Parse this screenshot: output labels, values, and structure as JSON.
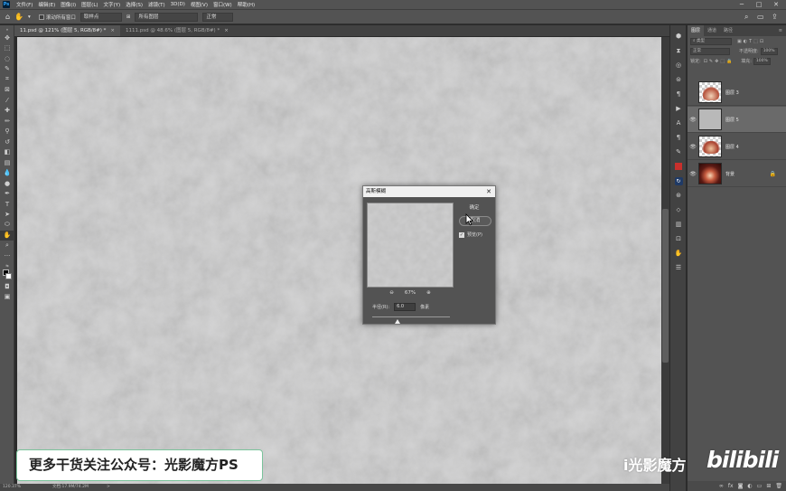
{
  "menu": {
    "logo": "Ps",
    "items": [
      "文件(F)",
      "编辑(E)",
      "图像(I)",
      "图层(L)",
      "文字(Y)",
      "选择(S)",
      "滤镜(T)",
      "3D(D)",
      "视图(V)",
      "窗口(W)",
      "帮助(H)"
    ],
    "window_controls": [
      "─",
      "□",
      "✕"
    ]
  },
  "options_bar": {
    "sample_all_layers": "滚动所有窗口",
    "sample_size": "取样点",
    "mode_label": "所有图层",
    "blend": "正常"
  },
  "tabs": [
    {
      "label": "11.psd @ 121% (图层 5, RGB/8#) *",
      "close": "×",
      "active": true
    },
    {
      "label": "1111.psd @ 48.6% (图层 5, RGB/8#) *",
      "close": "×",
      "active": false
    }
  ],
  "statusbar": {
    "zoom": "120.37%",
    "doc": "文档:17.9M/74.2M",
    "arrow": ">"
  },
  "layers_panel": {
    "tabs": [
      "图层",
      "通道",
      "路径"
    ],
    "kind_label": "类型",
    "blend_mode": "正常",
    "opacity_label": "不透明度:",
    "opacity_value": "100%",
    "lock_label": "锁定:",
    "fill_label": "填充:",
    "fill_value": "100%",
    "layers": [
      {
        "name": "图层 3",
        "visible": false,
        "selected": false,
        "thumb": "flame"
      },
      {
        "name": "图层 5",
        "visible": true,
        "selected": true,
        "thumb": "gray"
      },
      {
        "name": "图层 4",
        "visible": true,
        "selected": false,
        "thumb": "flame"
      },
      {
        "name": "背景",
        "visible": true,
        "selected": false,
        "thumb": "photo",
        "locked": true
      }
    ]
  },
  "dialog": {
    "title": "高斯模糊",
    "close": "✕",
    "ok": "确定",
    "cancel": "取消",
    "preview_label": "预览(P)",
    "preview_checked": true,
    "zoom_out": "⊖",
    "zoom_value": "67%",
    "zoom_in": "⊕",
    "radius_label": "半径(R):",
    "radius_value": "6.0",
    "radius_unit": "像素",
    "radius_slider_fraction": 0.33
  },
  "overlay": {
    "promo_text": "更多干货关注公众号：光影魔方PS",
    "watermark_name": "i光影魔方",
    "watermark_logo": "bilibili"
  },
  "colors": {
    "ui_dark": "#535353",
    "canvas_gray": "#bcbcbc",
    "ps_blue": "#31a8ff"
  }
}
